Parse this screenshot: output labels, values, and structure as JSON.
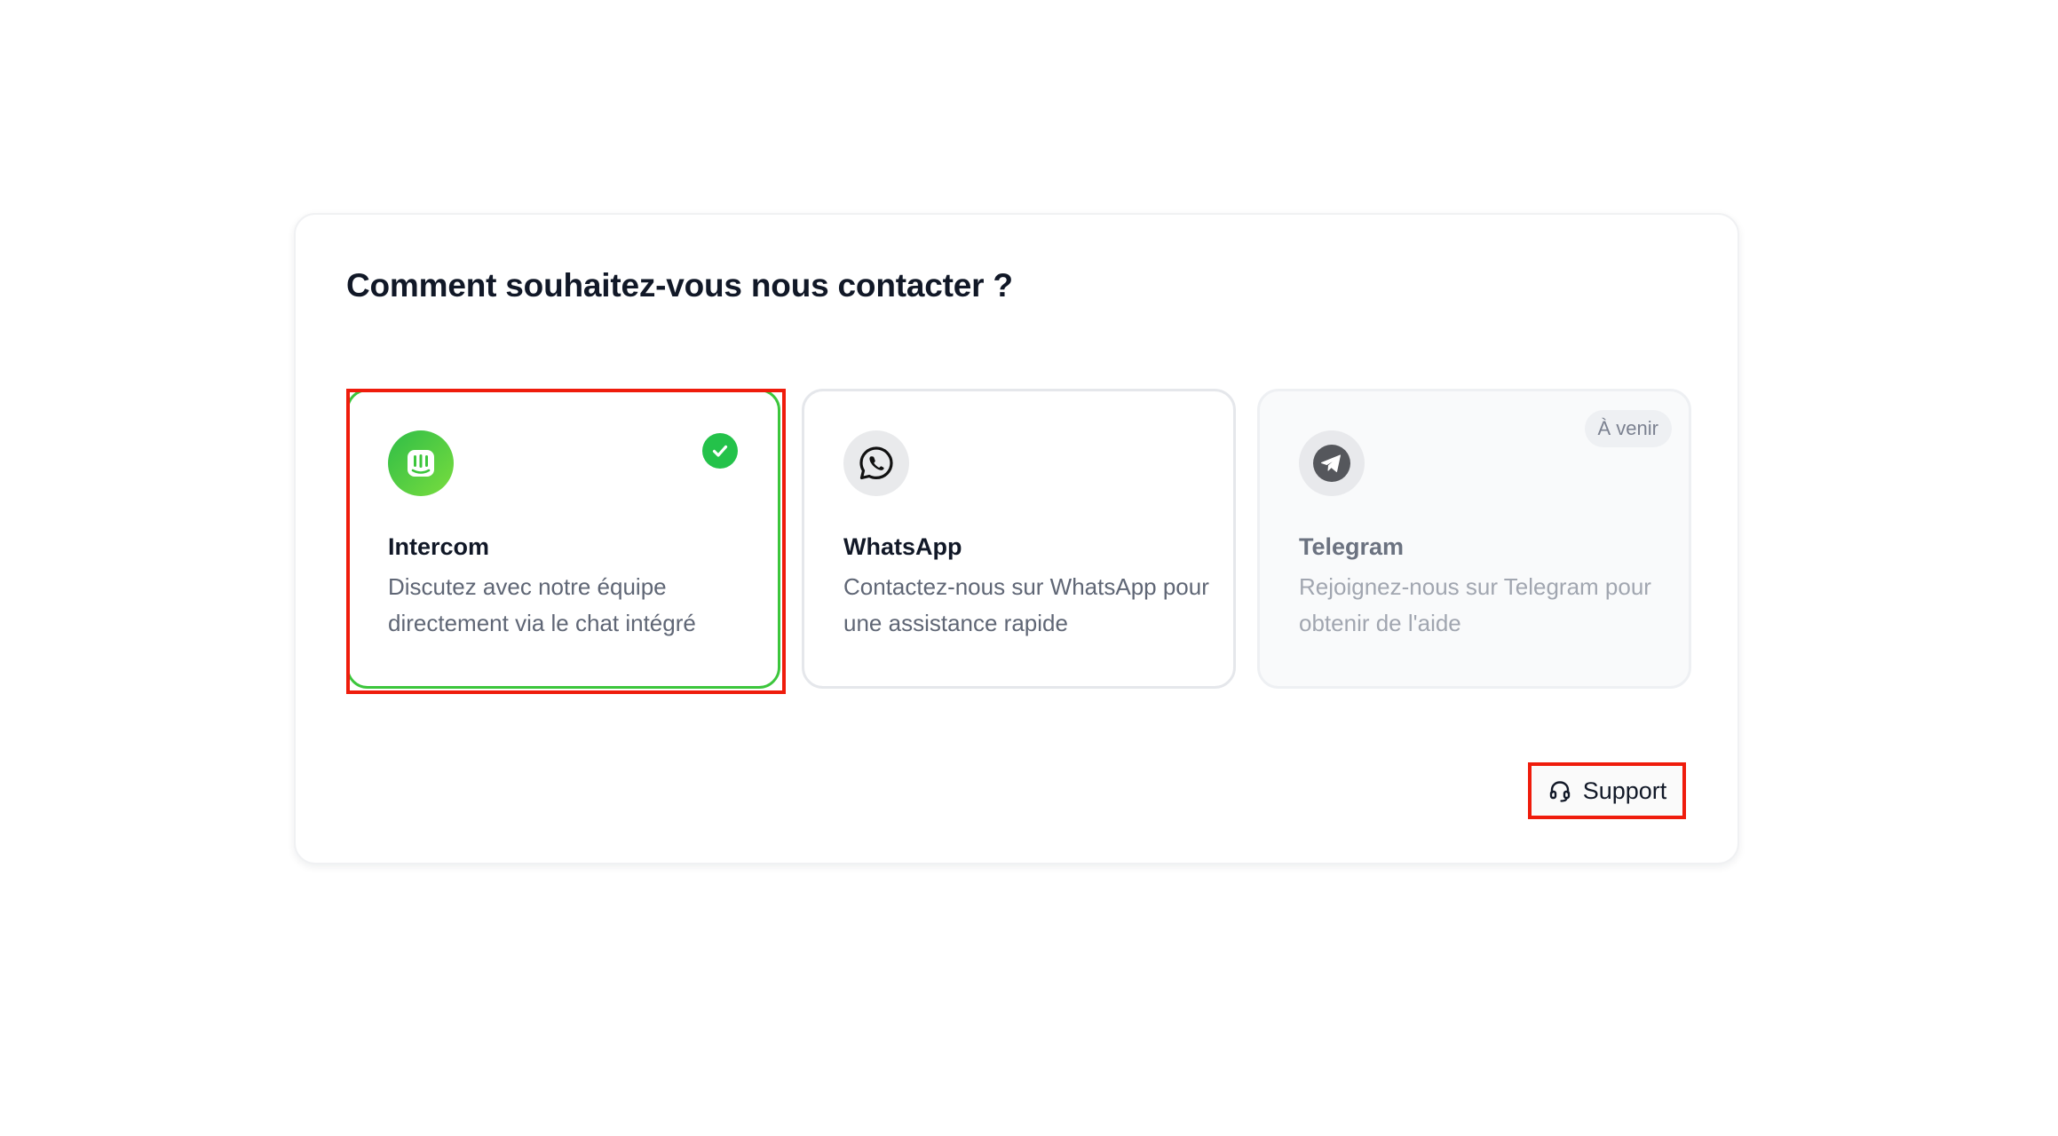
{
  "panel": {
    "title": "Comment souhaitez-vous nous contacter ?"
  },
  "options": [
    {
      "id": "intercom",
      "title": "Intercom",
      "description": "Discutez avec notre équipe directement via le chat intégré",
      "selected": true,
      "icon": "intercom-icon"
    },
    {
      "id": "whatsapp",
      "title": "WhatsApp",
      "description": "Contactez-nous sur WhatsApp pour une assistance rapide",
      "selected": false,
      "icon": "whatsapp-icon"
    },
    {
      "id": "telegram",
      "title": "Telegram",
      "description": "Rejoignez-nous sur Telegram pour obtenir de l'aide",
      "selected": false,
      "badge": "À venir",
      "icon": "telegram-icon"
    }
  ],
  "support": {
    "label": "Support",
    "icon": "headset-icon"
  },
  "colors": {
    "accent_green": "#24c24a",
    "highlight_red": "#ef1c0c",
    "text_primary": "#111827",
    "text_secondary": "#5f6675"
  }
}
